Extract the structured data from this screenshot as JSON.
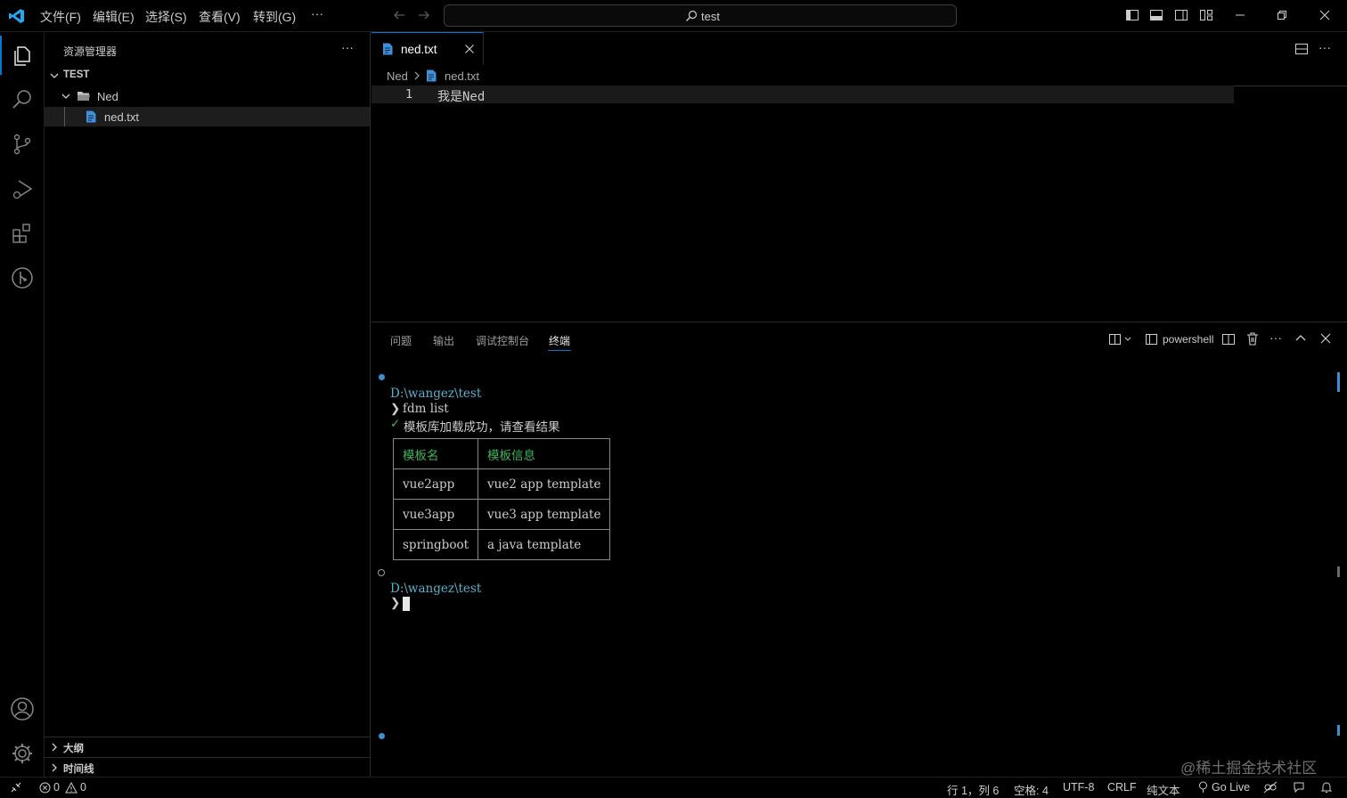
{
  "titlebar": {
    "menu": [
      "文件(F)",
      "编辑(E)",
      "选择(S)",
      "查看(V)",
      "转到(G)"
    ],
    "more": "···",
    "search_text": "test"
  },
  "activity": {
    "icons": [
      "explorer-icon",
      "search-icon",
      "source-control-icon",
      "run-debug-icon",
      "extensions-icon",
      "git-graph-icon",
      "account-icon",
      "settings-icon"
    ]
  },
  "sidebar": {
    "title": "资源管理器",
    "more": "···",
    "workspace": "TEST",
    "folder": "Ned",
    "file": "ned.txt",
    "outline": "大纲",
    "timeline": "时间线"
  },
  "editor": {
    "tab_label": "ned.txt",
    "breadcrumb": [
      "Ned",
      "ned.txt"
    ],
    "line_number": "1",
    "line_text": "我是Ned"
  },
  "panel": {
    "tabs": [
      "问题",
      "输出",
      "调试控制台",
      "终端"
    ],
    "active_tab": "终端",
    "shell": "powershell",
    "terminal": {
      "path1": "D:\\wangez\\test",
      "prompt": "❯",
      "command": "fdm list",
      "check": "✓",
      "success": "模板库加载成功，请查看结果",
      "table_headers": [
        "模板名",
        "模板信息"
      ],
      "table_rows": [
        [
          "vue2app",
          "vue2 app template"
        ],
        [
          "vue3app",
          "vue3 app template"
        ],
        [
          "springboot",
          "a java template"
        ]
      ],
      "path2": "D:\\wangez\\test"
    }
  },
  "statusbar": {
    "errors": "0",
    "warnings": "0",
    "position": "行 1，列 6",
    "spaces": "空格: 4",
    "encoding": "UTF-8",
    "eol": "CRLF",
    "language": "纯文本",
    "golive": "Go Live"
  },
  "watermark": "@稀土掘金技术社区",
  "colors": {
    "accent": "#0078d4",
    "terminal_cyan": "#5ab0c8",
    "terminal_green": "#3fb35c"
  }
}
